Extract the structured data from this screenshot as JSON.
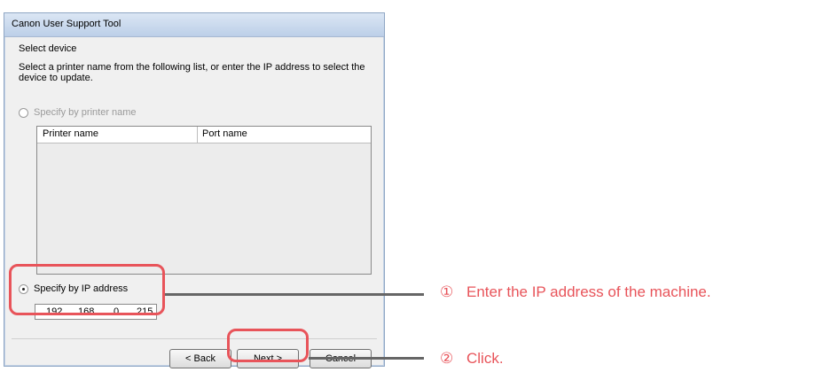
{
  "window": {
    "title": "Canon User Support Tool"
  },
  "dialog": {
    "section_title": "Select device",
    "instruction": "Select a printer name from the following list, or enter the IP address to select the device to update.",
    "radio_printer_name": "Specify by printer name",
    "list_columns": [
      "Printer name",
      "Port name"
    ],
    "radio_ip": "Specify by IP address",
    "ip_address": [
      "192",
      "168",
      "0",
      "215"
    ],
    "ip_dot": "."
  },
  "buttons": {
    "back": "< Back",
    "next": "Next >",
    "cancel": "Cancel"
  },
  "callouts": [
    {
      "number": "①",
      "text": "Enter the IP address of the machine."
    },
    {
      "number": "②",
      "text": "Click."
    }
  ],
  "colors": {
    "highlight": "#e8545a",
    "title_gradient": "#bccfe8"
  }
}
